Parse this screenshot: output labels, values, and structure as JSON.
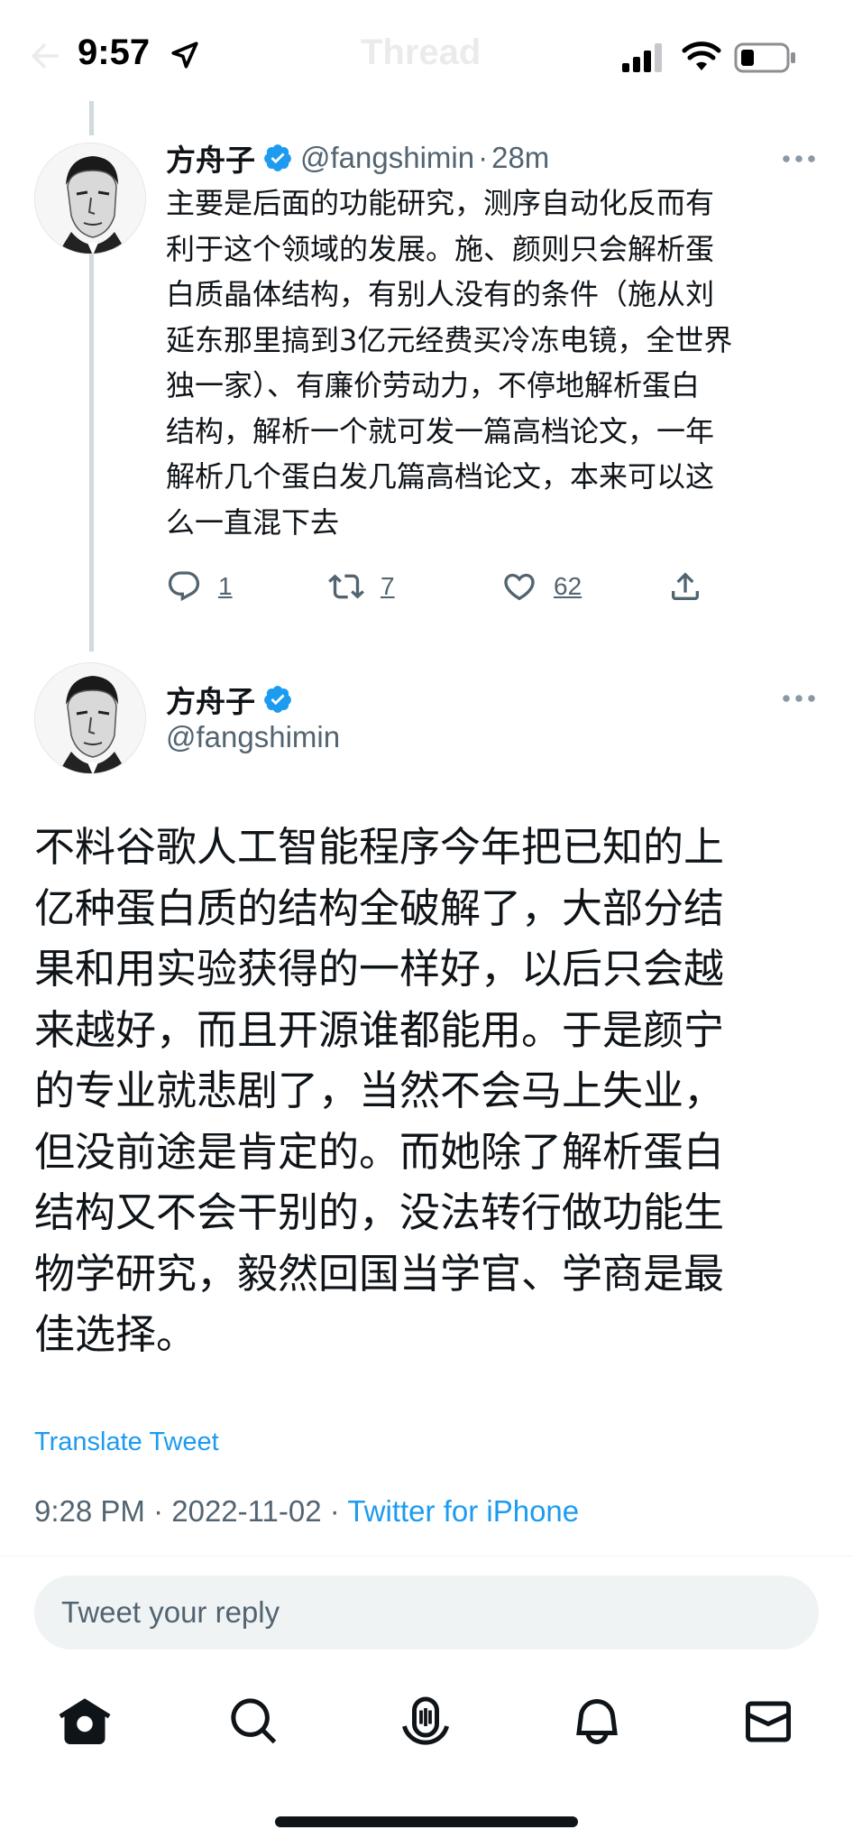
{
  "status_bar": {
    "time": "9:57"
  },
  "nav": {
    "title": "Thread"
  },
  "parent_tweet": {
    "name": "方舟子",
    "handle": "@fangshimin",
    "separator": "·",
    "time_ago": "28m",
    "text": "主要是后面的功能研究，测序自动化反而有\n利于这个领域的发展。施、颜则只会解析蛋\n白质晶体结构，有别人没有的条件（施从刘\n延东那里搞到3亿元经费买冷冻电镜，全世界\n独一家）、有廉价劳动力，不停地解析蛋白\n结构，解析一个就可发一篇高档论文，一年\n解析几个蛋白发几篇高档论文，本来可以这\n么一直混下去",
    "replies": "1",
    "retweets": "7",
    "likes": "62"
  },
  "main_tweet": {
    "name": "方舟子",
    "handle": "@fangshimin",
    "text": "不料谷歌人工智能程序今年把已知的上\n亿种蛋白质的结构全破解了，大部分结\n果和用实验获得的一样好，以后只会越\n来越好，而且开源谁都能用。于是颜宁\n的专业就悲剧了，当然不会马上失业，\n但没前途是肯定的。而她除了解析蛋白\n结构又不会干别的，没法转行做功能生\n物学研究，毅然回国当学官、学商是最\n佳选择。",
    "translate_label": "Translate Tweet",
    "time": "9:28 PM",
    "date": "2022-11-02",
    "source": "Twitter for iPhone"
  },
  "reply": {
    "placeholder": "Tweet your reply"
  },
  "tabs": [
    "home-icon",
    "search-icon",
    "spaces-icon",
    "notifications-icon",
    "messages-icon"
  ],
  "colors": {
    "accent": "#1d9bf0",
    "text": "#0f1419",
    "secondary": "#536471",
    "thread_line": "#cfd9de"
  }
}
